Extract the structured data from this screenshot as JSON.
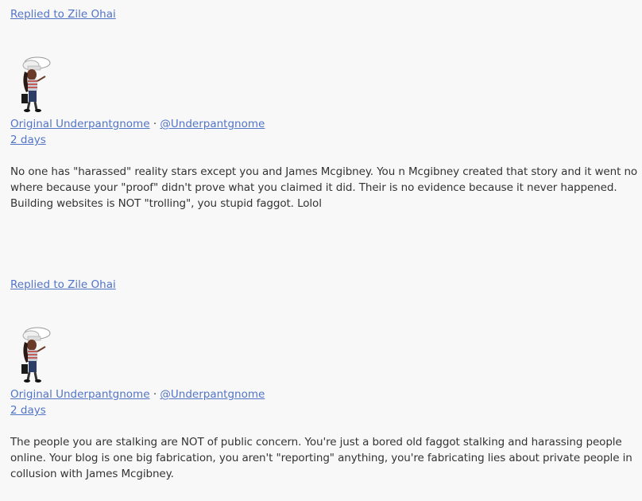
{
  "posts": [
    {
      "reply_label": "Replied to Zile Ohai",
      "author_name": "Original Underpantgnome",
      "separator": "·",
      "author_handle": "@Underpantgnome",
      "time_ago": "2 days",
      "body": "No one has \"harassed\" reality stars except you and James Mcgibney. You n Mcgibney created that story and it went no where because your \"proof\" didn't prove what you claimed it did. Their is no evidence because it never happened. Building websites is NOT \"trolling\", you stupid faggot. Lolol"
    },
    {
      "reply_label": "Replied to Zile Ohai",
      "author_name": "Original Underpantgnome",
      "separator": "·",
      "author_handle": "@Underpantgnome",
      "time_ago": "2 days",
      "body": "The people you are stalking are NOT of public concern. You're just a bored old faggot stalking and harassing people online. Your blog is one big fabrication, you aren't \"reporting\" anything, you're fabricating lies about private people in collusion with James Mcgibney."
    }
  ],
  "colors": {
    "link": "#5274c7",
    "text": "#333333",
    "background": "#f8f8f9"
  },
  "icons": {
    "avatar": "gnome-chef-avatar-icon"
  }
}
